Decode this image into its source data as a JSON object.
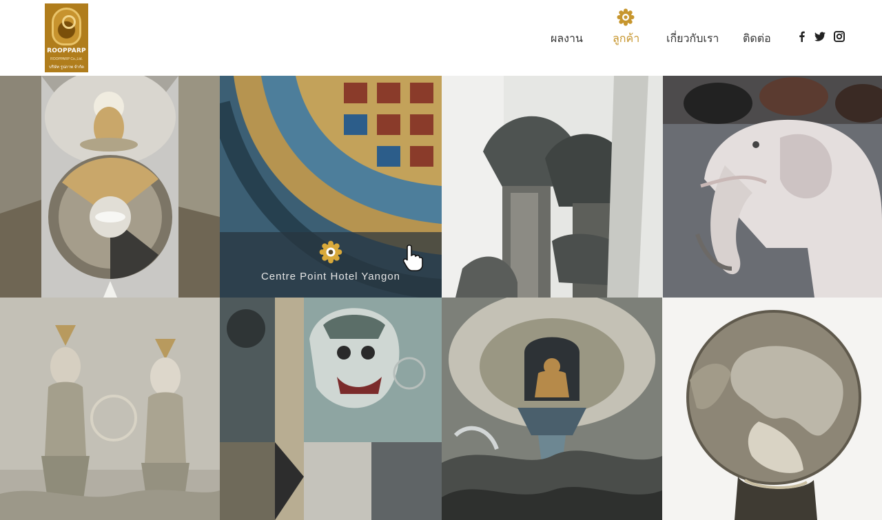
{
  "logo": {
    "word": "ROOPPARP",
    "sub1": "ROOPPARP Co.,Ltd.",
    "sub2": "บริษัท รูปภาพ จำกัด",
    "color": "#b07d1c"
  },
  "nav": {
    "items": [
      {
        "label": "ผลงาน",
        "active": false
      },
      {
        "label": "ลูกค้า",
        "active": true
      },
      {
        "label": "เกี่ยวกับเรา",
        "active": false
      },
      {
        "label": "ติดต่อ",
        "active": false
      }
    ],
    "active_color": "#c7962e",
    "social": [
      "facebook-icon",
      "twitter-icon",
      "instagram-icon"
    ]
  },
  "gallery": {
    "tiles": [
      {
        "subject": "buddha-mural"
      },
      {
        "subject": "ornamental-ceiling",
        "hover_caption": "Centre Point Hotel Yangon"
      },
      {
        "subject": "pillars-sculpture"
      },
      {
        "subject": "elephant-sculpture"
      },
      {
        "subject": "deity-mural"
      },
      {
        "subject": "giant-mask-panel"
      },
      {
        "subject": "buddha-relief"
      },
      {
        "subject": "bronze-globe"
      }
    ]
  }
}
